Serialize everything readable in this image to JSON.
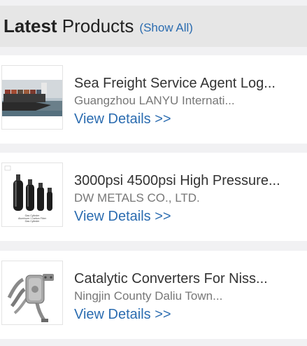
{
  "header": {
    "title_bold": "Latest",
    "title_rest": " Products",
    "show_all": "(Show All)"
  },
  "products": [
    {
      "title": "Sea Freight Service Agent Log...",
      "company": "Guangzhou LANYU Internati...",
      "link": "View Details >>",
      "image_icon": "cargo-ship-image"
    },
    {
      "title": "3000psi 4500psi High Pressure...",
      "company": "DW METALS CO., LTD.",
      "link": "View Details >>",
      "image_icon": "gas-cylinders-image",
      "image_caption": [
        "Gas Cylinder",
        "Aluminum / Carbon Fiber",
        "Gas Cylinder"
      ]
    },
    {
      "title": "Catalytic Converters For Niss...",
      "company": "Ningjin County Daliu Town...",
      "link": "View Details >>",
      "image_icon": "catalytic-converter-image"
    }
  ],
  "colors": {
    "link": "#2b6cb0",
    "header_bg": "#e6e6e6",
    "page_bg": "#f1f1f3"
  }
}
